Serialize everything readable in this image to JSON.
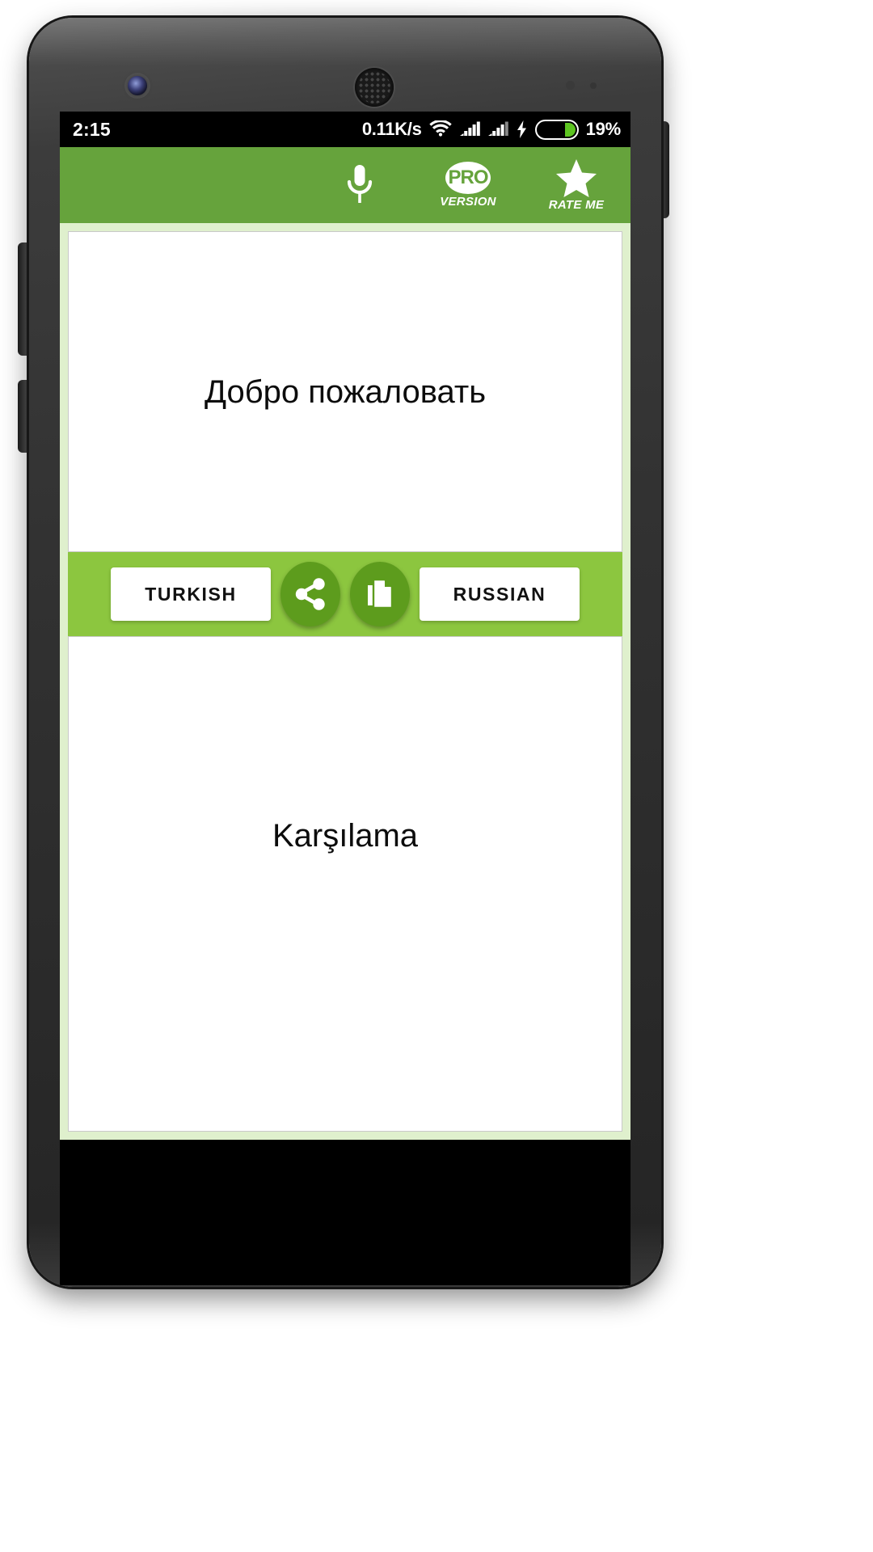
{
  "status_bar": {
    "time": "2:15",
    "network_speed": "0.11K/s",
    "wifi_icon": "wifi-icon",
    "signal_icon_1": "signal-bars-icon",
    "signal_icon_2": "signal-bars-icon",
    "charging_icon": "lightning-bolt-icon",
    "battery_icon": "battery-icon",
    "battery_percent": "19%",
    "battery_fill_color": "#5dc421",
    "background_color": "#000000"
  },
  "app_bar": {
    "background_color": "#66a33c",
    "actions": [
      {
        "name": "voice-input",
        "icon": "microphone-icon",
        "caption": ""
      },
      {
        "name": "pro-version",
        "icon": "pro-badge-icon",
        "badge_text": "PRO",
        "caption": "VERSION"
      },
      {
        "name": "rate-me",
        "icon": "star-icon",
        "caption": "RATE ME"
      }
    ]
  },
  "body": {
    "background_color": "#dff0cd",
    "source_panel": {
      "text": "Добро пожаловать"
    },
    "target_panel": {
      "text": "Karşılama"
    }
  },
  "action_strip": {
    "background_color": "#8cc63f",
    "button_color": "#5d9c1d",
    "source_language": "TURKISH",
    "target_language": "RUSSIAN",
    "share_icon": "share-icon",
    "copy_icon": "copy-document-icon"
  },
  "device": {
    "front_camera": "front-camera-icon",
    "earpiece": "earpiece-speaker-icon",
    "body_color": "#323232"
  }
}
